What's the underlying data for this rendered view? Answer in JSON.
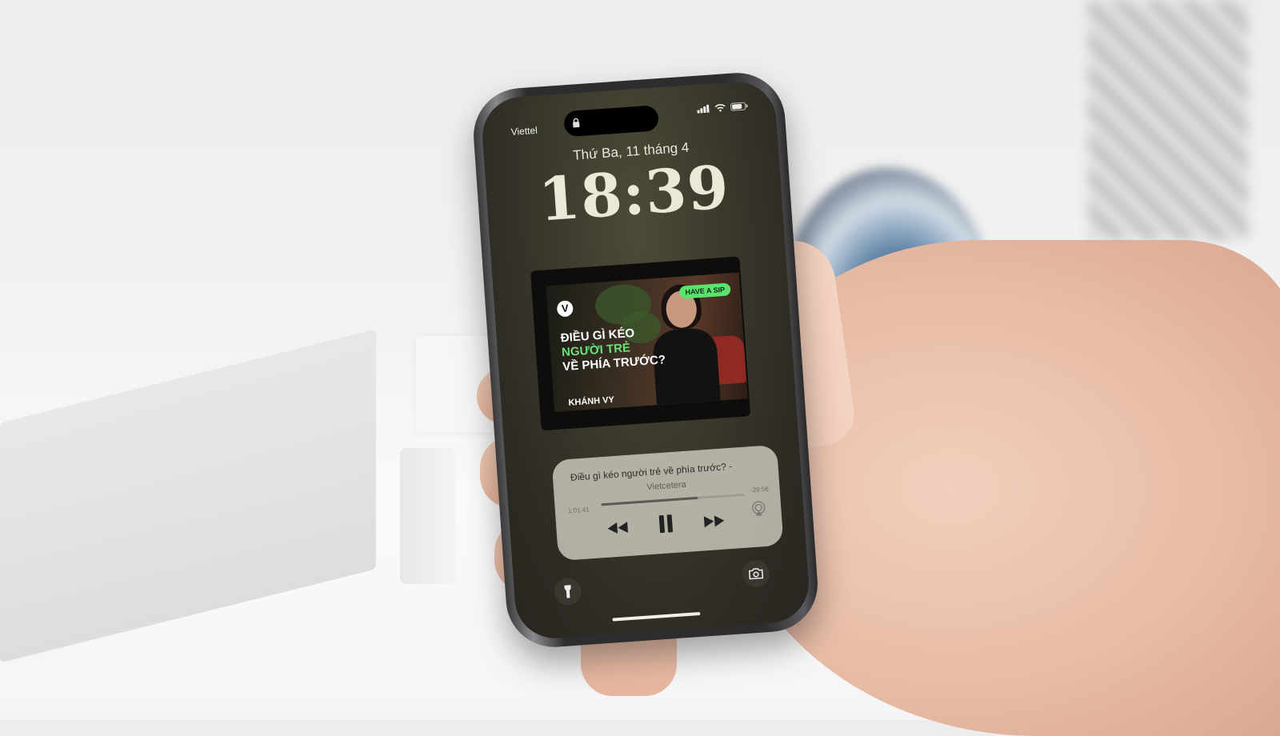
{
  "lockscreen": {
    "carrier": "Viettel",
    "date": "Thứ Ba, 11 tháng 4",
    "time": "18:39"
  },
  "artwork": {
    "logo": "V",
    "badge": "HAVE A SIP",
    "title_line1": "ĐIỀU GÌ KÉO",
    "title_line2": "NGƯỜI TRẺ",
    "title_line3": "VỀ PHÍA TRƯỚC?",
    "name": "KHÁNH VY"
  },
  "player": {
    "title": "Điều gì kéo người trẻ về phía trước? -",
    "artist": "Vietcetera",
    "elapsed": "1:01:41",
    "remaining": "-29:56",
    "progress": 0.67
  },
  "icons": {
    "lock": "lock-icon",
    "signal": "signal-icon",
    "wifi": "wifi-icon",
    "battery": "battery-icon",
    "rewind": "rewind-icon",
    "pause": "pause-icon",
    "forward": "fast-forward-icon",
    "airplay": "airplay-icon",
    "flashlight": "flashlight-icon",
    "camera": "camera-icon"
  }
}
